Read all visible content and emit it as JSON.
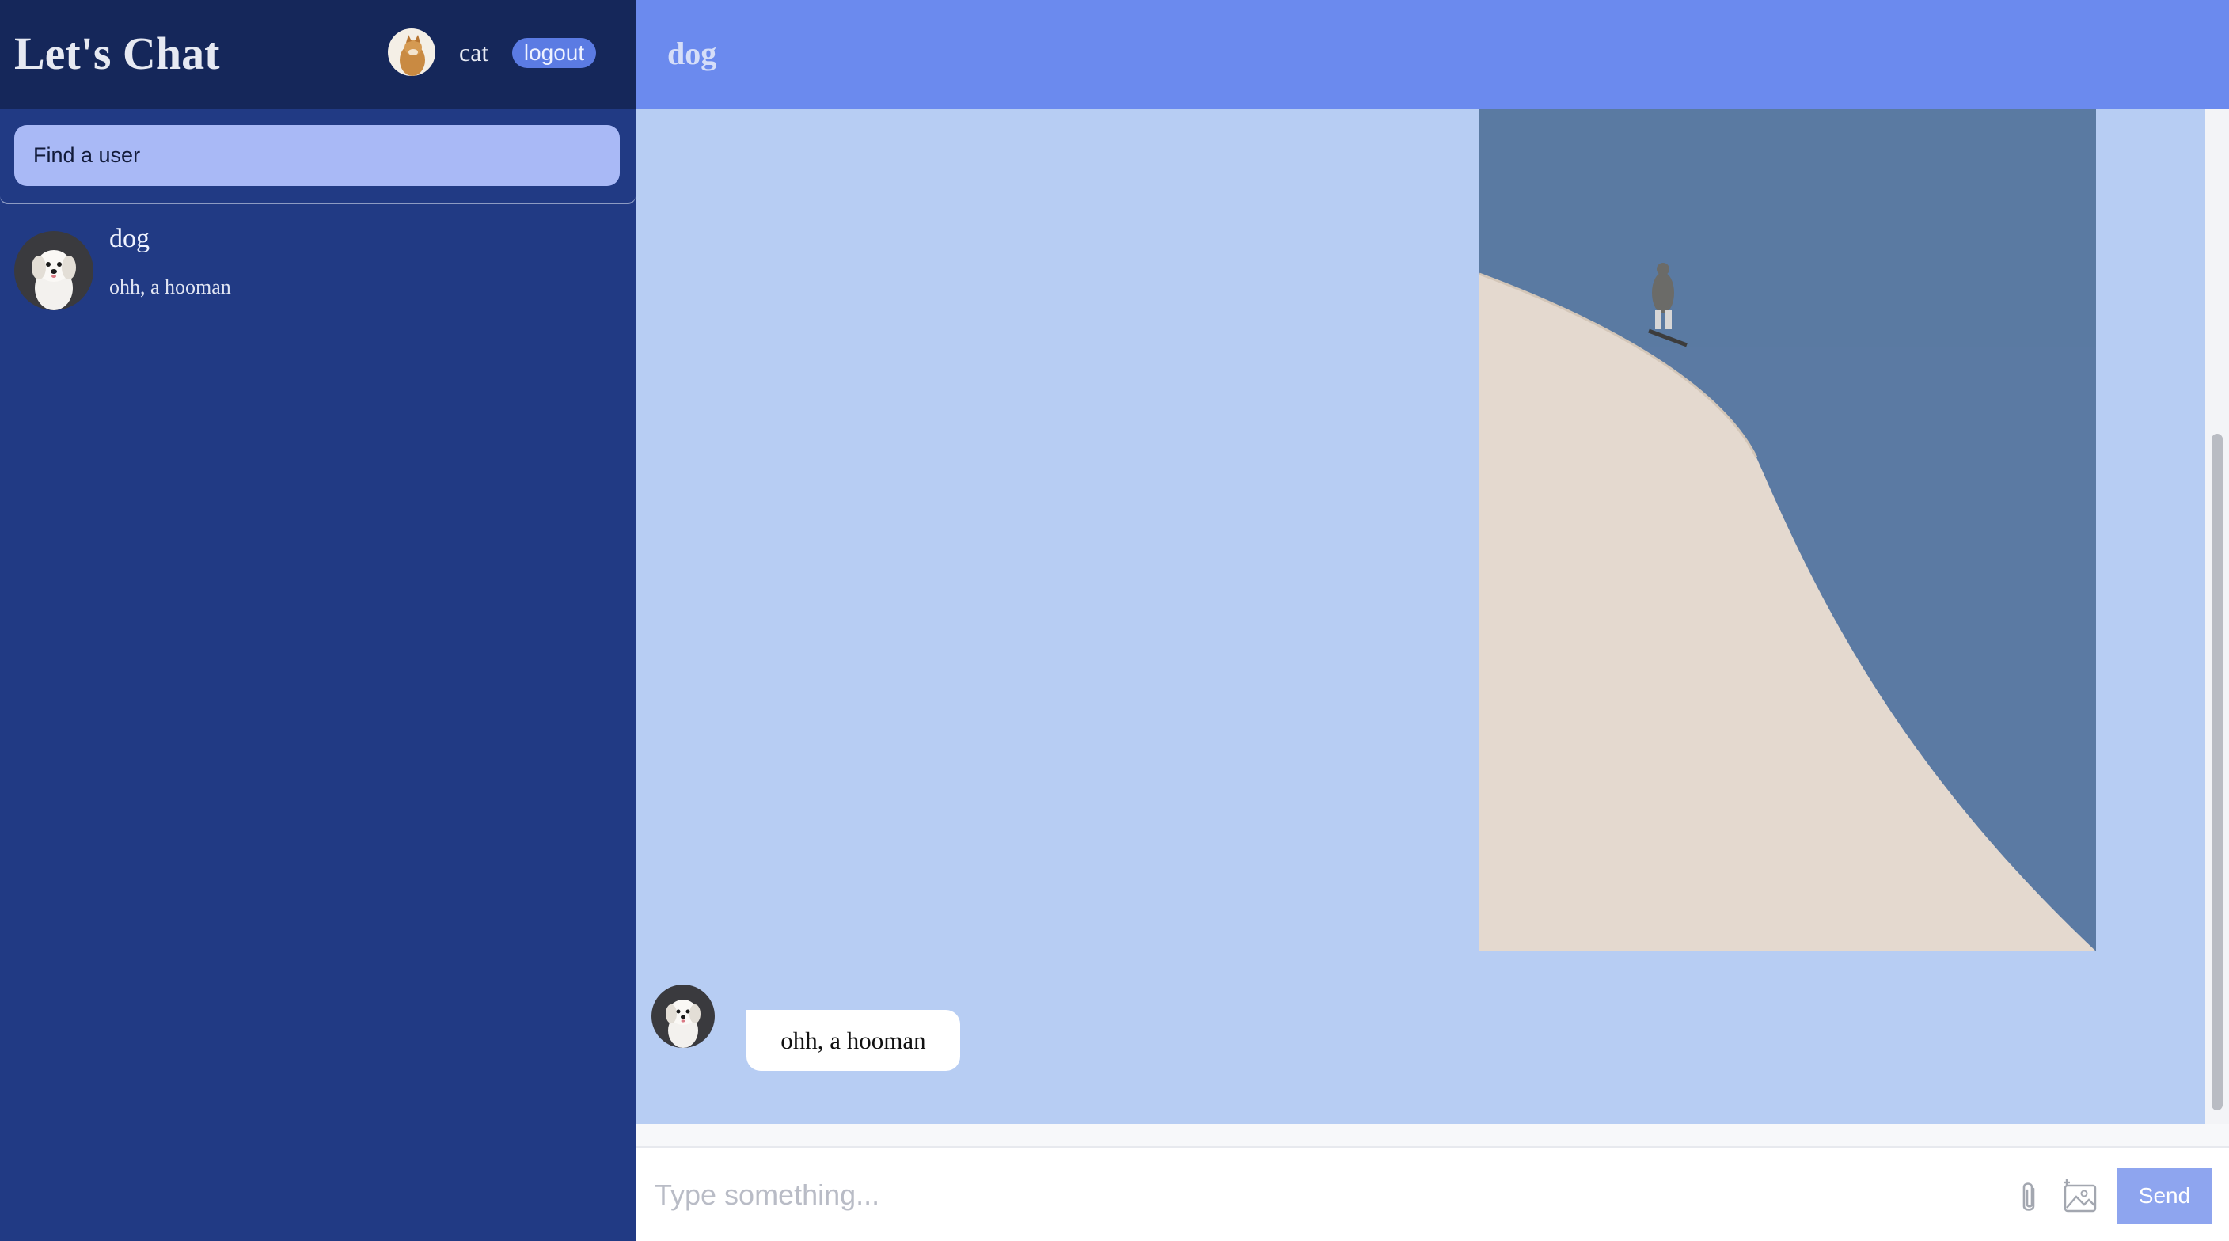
{
  "sidebar": {
    "app_title": "Let's Chat",
    "current_user": {
      "name": "cat",
      "avatar_icon": "cat-avatar"
    },
    "logout_label": "logout",
    "search": {
      "placeholder": "Find a user"
    },
    "chats": [
      {
        "name": "dog",
        "last_message": "ohh, a hooman",
        "avatar_icon": "dog-avatar"
      }
    ]
  },
  "main": {
    "chat_title": "dog",
    "messages": [
      {
        "type": "image",
        "sender": "self",
        "content": "skater-on-ramp-photo"
      },
      {
        "type": "text",
        "sender": "dog",
        "text": "ohh, a hooman"
      }
    ],
    "input": {
      "placeholder": "Type something...",
      "value": ""
    },
    "send_label": "Send"
  },
  "colors": {
    "sidebar_bg": "#213a84",
    "sidebar_header_bg": "#15275a",
    "main_header_bg": "#6b8aee",
    "chat_bg": "#b7cdf3",
    "search_bg": "#a9b9f6",
    "logout_bg": "#5b7be3",
    "send_bg": "#8ea5ef"
  }
}
